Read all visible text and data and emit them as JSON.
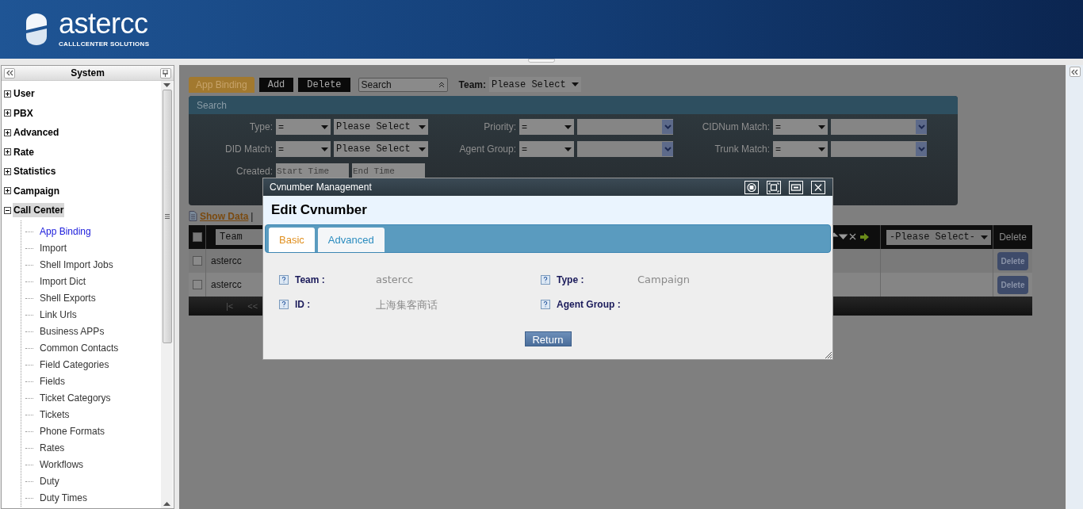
{
  "header": {
    "logo_text": "astercc",
    "tagline": "CALLLCENTER SOLUTIONS"
  },
  "sidebar": {
    "title": "System",
    "items": [
      {
        "label": "User",
        "expanded": false,
        "selected": false
      },
      {
        "label": "PBX",
        "expanded": false,
        "selected": false
      },
      {
        "label": "Advanced",
        "expanded": false,
        "selected": false
      },
      {
        "label": "Rate",
        "expanded": false,
        "selected": false
      },
      {
        "label": "Statistics",
        "expanded": false,
        "selected": false
      },
      {
        "label": "Campaign",
        "expanded": false,
        "selected": false
      },
      {
        "label": "Call Center",
        "expanded": true,
        "selected": true,
        "children": [
          {
            "label": "App Binding",
            "selected": true
          },
          {
            "label": "Import",
            "selected": false
          },
          {
            "label": "Shell Import Jobs",
            "selected": false
          },
          {
            "label": "Import Dict",
            "selected": false
          },
          {
            "label": "Shell Exports",
            "selected": false
          },
          {
            "label": "Link Urls",
            "selected": false
          },
          {
            "label": "Business APPs",
            "selected": false
          },
          {
            "label": "Common Contacts",
            "selected": false
          },
          {
            "label": "Field Categories",
            "selected": false
          },
          {
            "label": "Fields",
            "selected": false
          },
          {
            "label": "Ticket Categorys",
            "selected": false
          },
          {
            "label": "Tickets",
            "selected": false
          },
          {
            "label": "Phone Formats",
            "selected": false
          },
          {
            "label": "Rates",
            "selected": false
          },
          {
            "label": "Workflows",
            "selected": false
          },
          {
            "label": "Duty",
            "selected": false
          },
          {
            "label": "Duty Times",
            "selected": false
          }
        ]
      }
    ]
  },
  "toolbar": {
    "tabs": [
      {
        "label": "App Binding",
        "selected": true
      }
    ],
    "buttons": [
      "Add",
      "Delete"
    ],
    "search_select": "Search",
    "team_label": "Team:",
    "team_value": "Please Select"
  },
  "search": {
    "title": "Search",
    "filters": [
      {
        "label": "Type:",
        "operator": "=",
        "value": "Please Select",
        "kind": "select"
      },
      {
        "label": "Priority:",
        "operator": "=",
        "kind": "combo"
      },
      {
        "label": "CIDNum Match:",
        "operator": "=",
        "kind": "combo"
      },
      {
        "label": "DID Match:",
        "operator": "=",
        "value": "Please Select",
        "kind": "select"
      },
      {
        "label": "Agent Group:",
        "operator": "=",
        "kind": "combo"
      },
      {
        "label": "Trunk Match:",
        "operator": "=",
        "kind": "combo"
      }
    ],
    "created": {
      "label": "Created:",
      "start_placeholder": "Start Time",
      "end_placeholder": "End Time"
    }
  },
  "links": {
    "show_data": "Show Data",
    "separator": "|"
  },
  "table": {
    "header": {
      "checked": false,
      "team_filter": "Team",
      "status_filter": "-Please Select-",
      "delete_column": "Delete"
    },
    "rows": [
      {
        "checked": false,
        "team": "astercc",
        "delete": "Delete"
      },
      {
        "checked": false,
        "team": "astercc",
        "delete": "Delete"
      }
    ],
    "pager": [
      "|<",
      "<<"
    ]
  },
  "dialog": {
    "title": "Cvnumber Management",
    "heading": "Edit Cvnumber",
    "tabs": [
      {
        "label": "Basic",
        "selected": true
      },
      {
        "label": "Advanced",
        "selected": false
      }
    ],
    "fields": [
      {
        "label": "Team :",
        "value": "astercc"
      },
      {
        "label": "Type :",
        "value": "Campaign"
      },
      {
        "label": "ID :",
        "value": "上海集客商话"
      },
      {
        "label": "Agent Group :"
      }
    ],
    "button": "Return"
  }
}
